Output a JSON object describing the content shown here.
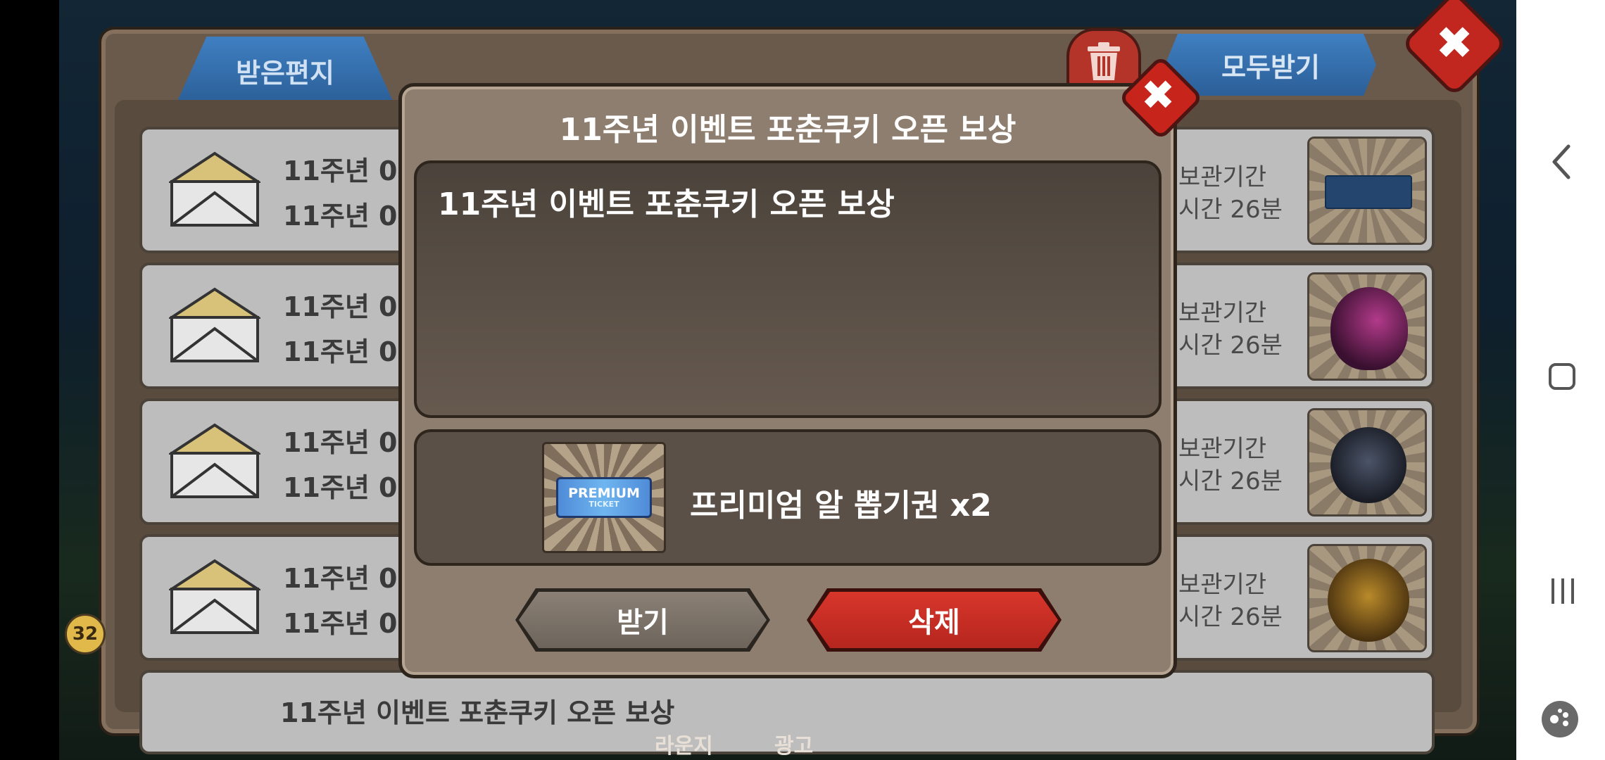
{
  "mailbox": {
    "tab_received": "받은편지",
    "receive_all": "모두받기"
  },
  "rows": [
    {
      "t1": "11주년 0",
      "t2": "11주년 0",
      "k1": "보관기간",
      "k2": "시간 26분",
      "thumb": "premium-ticket-thumb"
    },
    {
      "t1": "11주년 0",
      "t2": "11주년 0",
      "k1": "보관기간",
      "k2": "시간 26분",
      "thumb": "dragon-egg-purple"
    },
    {
      "t1": "11주년 0",
      "t2": "11주년 0",
      "k1": "보관기간",
      "k2": "시간 26분",
      "thumb": "dragon-egg-dark"
    },
    {
      "t1": "11주년 0",
      "t2": "11주년 0",
      "k1": "보관기간",
      "k2": "시간 26분",
      "thumb": "dragon-egg-gold"
    }
  ],
  "row_partial": "11주년 이벤트 포춘쿠키 오픈 보상",
  "badge": "32",
  "modal": {
    "title": "11주년 이벤트 포춘쿠키 오픈 보상",
    "message": "11주년 이벤트 포춘쿠키 오픈 보상",
    "reward": {
      "ticket_main": "PREMIUM",
      "ticket_sub": "TICKET",
      "label": "프리미엄 알 뽑기권 x2"
    },
    "btn_receive": "받기",
    "btn_delete": "삭제"
  },
  "bottom_labels": [
    "라운지",
    "광고"
  ]
}
